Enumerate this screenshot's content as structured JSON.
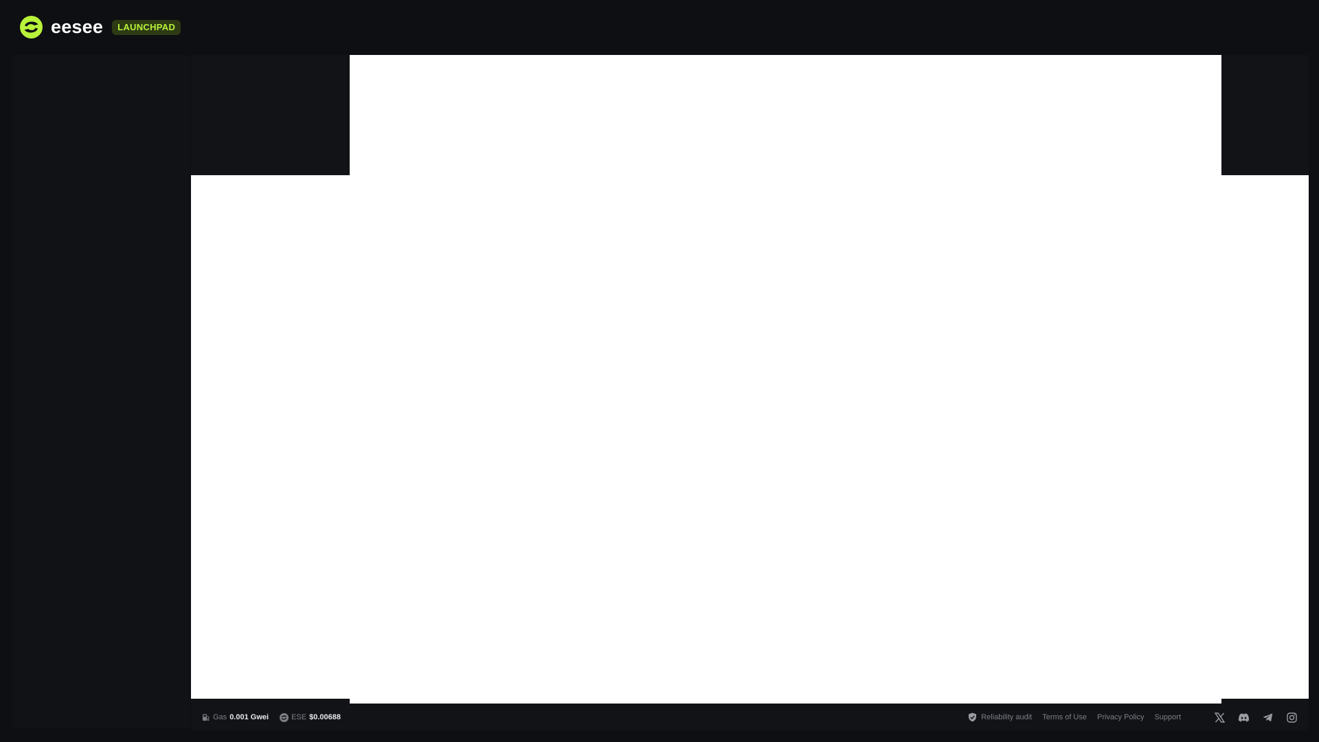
{
  "header": {
    "brand_name": "eesee",
    "badge": "LAUNCHPAD",
    "accent_color": "#b9f23a"
  },
  "footer": {
    "gas": {
      "label": "Gas",
      "value": "0.001 Gwei",
      "icon": "gas-pump-icon"
    },
    "token": {
      "label": "ESE",
      "value": "$0.00688",
      "icon": "eesee-token-icon"
    },
    "links": [
      {
        "label": "Reliability audit",
        "icon": "shield-check-icon"
      },
      {
        "label": "Terms of Use"
      },
      {
        "label": "Privacy Policy"
      },
      {
        "label": "Support"
      }
    ],
    "socials": [
      "x-icon",
      "discord-icon",
      "telegram-icon",
      "instagram-icon"
    ]
  }
}
